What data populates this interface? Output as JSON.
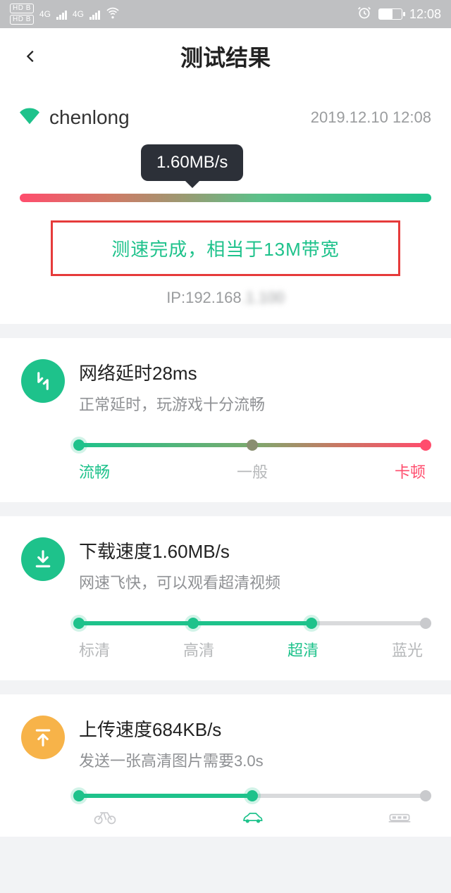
{
  "statusbar": {
    "net_label": "4G",
    "time": "12:08"
  },
  "header": {
    "title": "测试结果"
  },
  "network": {
    "ssid": "chenlong",
    "timestamp": "2019.12.10 12:08",
    "speed_bubble": "1.60MB/s",
    "result_text": "测速完成，相当于13M带宽",
    "ip_prefix": "IP:192.168",
    "ip_hidden": ".1.100"
  },
  "latency": {
    "title": "网络延时28ms",
    "subtitle": "正常延时，玩游戏十分流畅",
    "label_smooth": "流畅",
    "label_normal": "一般",
    "label_laggy": "卡顿"
  },
  "download": {
    "title": "下载速度1.60MB/s",
    "subtitle": "网速飞快，可以观看超清视频",
    "label_sd": "标清",
    "label_hd": "高清",
    "label_uhd": "超清",
    "label_bluray": "蓝光",
    "progress_pct": 67
  },
  "upload": {
    "title": "上传速度684KB/s",
    "subtitle": "发送一张高清图片需要3.0s",
    "progress_pct": 50
  }
}
